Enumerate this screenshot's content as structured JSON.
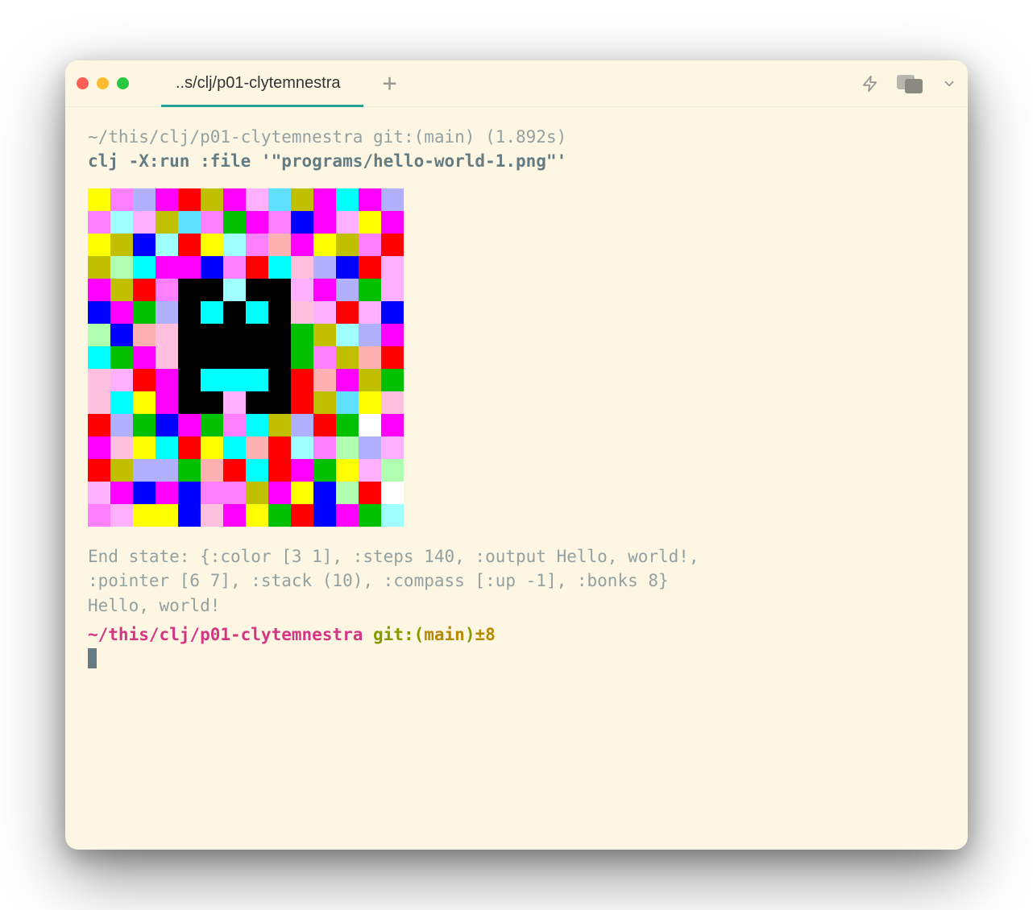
{
  "titlebar": {
    "tab_title": "..s/clj/p01-clytemnestra"
  },
  "icons": {
    "close_dot": "close",
    "min_dot": "minimize",
    "max_dot": "zoom",
    "new_tab": "+",
    "bolt": "bolt-icon",
    "panels": "panels-icon",
    "chevron": "chevron-down-icon"
  },
  "term": {
    "prompt1_path": "~/this/clj/p01-clytemnestra",
    "prompt1_git": " git:(main)",
    "prompt1_time": " (1.892s)",
    "command": "clj -X:run :file '\"programs/hello-world-1.png\"'",
    "out_line1": "End state: {:color [3 1], :steps 140, :output Hello, world!,",
    "out_line2": ":pointer [6 7], :stack (10), :compass [:up -1], :bonks 8}",
    "out_line3": "Hello, world!",
    "prompt2_path": "~/this/clj/p01-clytemnestra",
    "prompt2_git_a": " git:(",
    "prompt2_git_b": "main",
    "prompt2_git_c": ")",
    "prompt2_delta": "±8"
  },
  "pixel_art": {
    "palette": {
      "K": "#000000",
      "W": "#ffffff",
      "C": "#00ffff",
      "c": "#a0ffff",
      "M": "#ff00ff",
      "m": "#ffb0ff",
      "R": "#ff0000",
      "r": "#ffb0b0",
      "G": "#00c000",
      "g": "#b0ffb0",
      "B": "#0000ff",
      "b": "#b0b0ff",
      "Y": "#ffff00",
      "y": "#c0c000",
      "P": "#ff80ff",
      "p": "#ffc0e0",
      "s": "#60e0ff"
    },
    "rows": [
      "YPbMRyMmsyMCMb",
      "PcmysPGMPBMmYM",
      "YyBcRYcPrMYyPR",
      "ygCMMBPRCpbBRm",
      "MyRPKKcKKmMbGm",
      "BMGbKCKCKpmRmB",
      "gBrpKKKKKGycbM",
      "CGMpKKKKKGPyrR",
      "pmRMKCCCKRrMyG",
      "pCYMKKmKKRysYp",
      "RbGBMGPCybRGWM",
      "MpYCRYCrRcPgbm",
      "RybbGrRCRMGYmg",
      "mMBMBPPyMYBgRW",
      "PmYYBpMYGRBMGc"
    ]
  }
}
